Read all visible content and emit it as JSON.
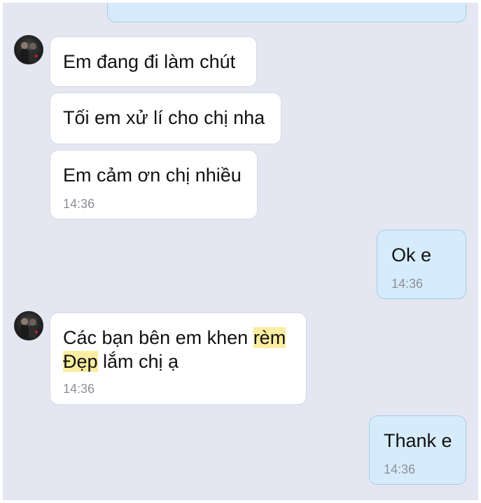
{
  "messages": [
    {
      "id": "m1",
      "direction": "incoming",
      "text": "Em đang đi làm chút"
    },
    {
      "id": "m2",
      "direction": "incoming",
      "text": "Tối em xử lí cho chị nha"
    },
    {
      "id": "m3",
      "direction": "incoming",
      "text": "Em cảm ơn chị nhiều",
      "time": "14:36"
    },
    {
      "id": "m4",
      "direction": "outgoing",
      "text": "Ok e",
      "time": "14:36"
    },
    {
      "id": "m5",
      "direction": "incoming",
      "line1_part1": "Các bạn bên em khen ",
      "line1_highlight": "rèm",
      "line2_highlight": "Đẹp",
      "line2_part2": " lắm chị ạ",
      "time": "14:36",
      "highlight_color": "#fbeda1"
    },
    {
      "id": "m6",
      "direction": "outgoing",
      "text": "Thank e",
      "time": "14:36"
    }
  ],
  "colors": {
    "background": "#e4e7f1",
    "incoming_bubble": "#ffffff",
    "outgoing_bubble": "#d6ecfc",
    "timestamp": "#8d8f95"
  },
  "icons": {
    "avatar": "contact-avatar"
  }
}
